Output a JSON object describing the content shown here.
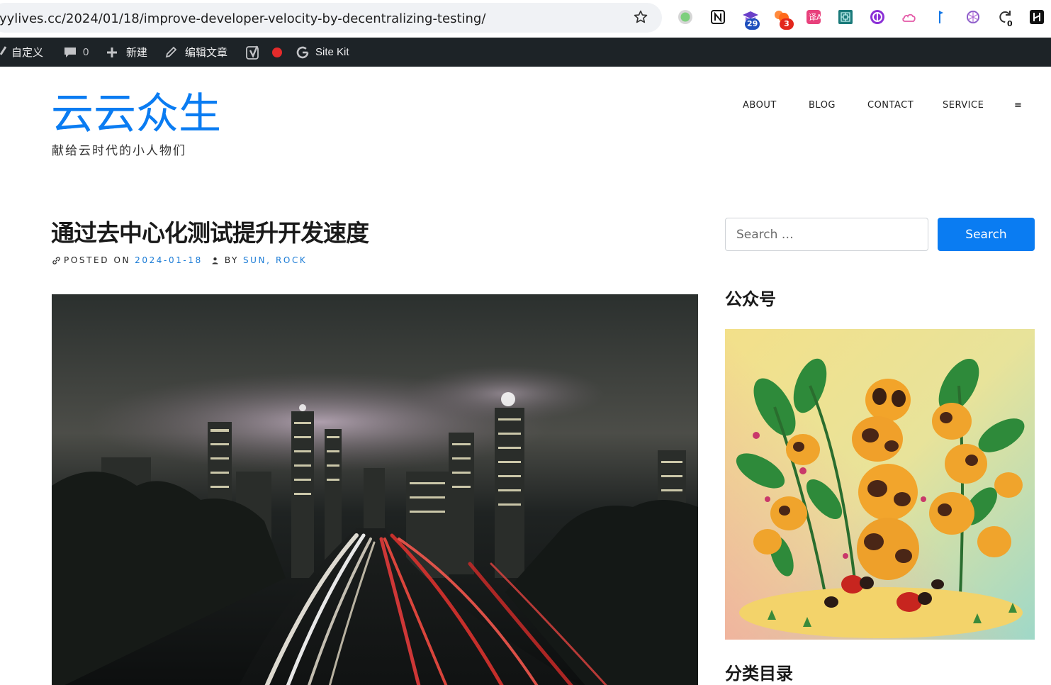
{
  "browser": {
    "url": "yylives.cc/2024/01/18/improve-developer-velocity-by-decentralizing-testing/",
    "extensions": [
      {
        "icon": "circle-extension-icon",
        "badge": ""
      },
      {
        "icon": "notion-icon",
        "badge": ""
      },
      {
        "icon": "graduation-cap-icon",
        "badge": "29"
      },
      {
        "icon": "orange-cluster-icon",
        "badge": "3"
      },
      {
        "icon": "translate-icon",
        "badge": ""
      },
      {
        "icon": "maze-icon",
        "badge": ""
      },
      {
        "icon": "purple-logo-icon",
        "badge": ""
      },
      {
        "icon": "cloud-icon",
        "badge": ""
      },
      {
        "icon": "blue-flag-icon",
        "badge": ""
      },
      {
        "icon": "openai-icon",
        "badge": ""
      },
      {
        "icon": "refresh-arrow-icon",
        "badge": "0"
      },
      {
        "icon": "dark-square-icon",
        "badge": ""
      }
    ]
  },
  "admin_bar": {
    "customize": "自定义",
    "comments_count": "0",
    "new": "新建",
    "edit_post": "编辑文章",
    "site_kit": "Site Kit"
  },
  "site": {
    "title": "云云众生",
    "tagline": "献给云时代的小人物们"
  },
  "nav": {
    "items": [
      "ABOUT",
      "BLOG",
      "CONTACT",
      "SERVICE"
    ],
    "menu_glyph": "≡"
  },
  "post": {
    "title": "通过去中心化测试提升开发速度",
    "posted_on_label": "POSTED ON",
    "date": "2024-01-18",
    "by_label": "BY",
    "authors": "SUN, ROCK"
  },
  "sidebar": {
    "search_placeholder": "Search …",
    "search_button": "Search",
    "widget1_title": "公众号",
    "widget2_title": "分类目录"
  },
  "colors": {
    "accent": "#0a7cf2",
    "admin_bar": "#1d2327",
    "meta_link": "#1a7bd6"
  }
}
